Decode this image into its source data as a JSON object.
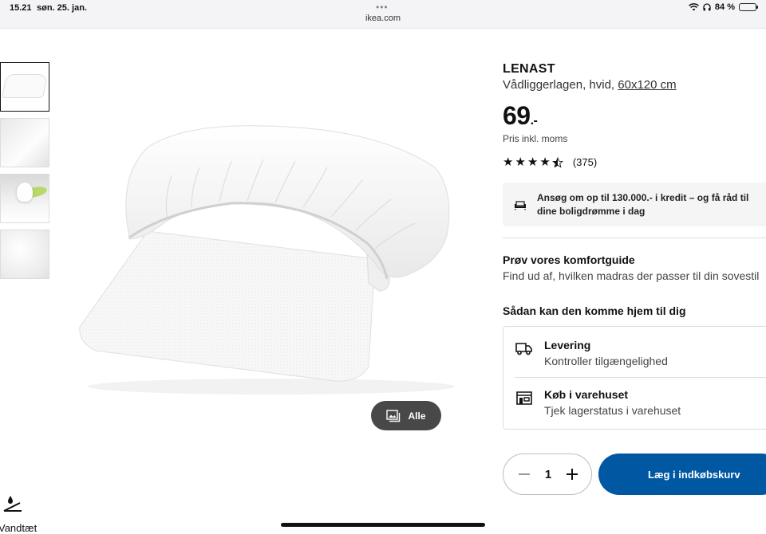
{
  "status_bar": {
    "time": "15.21",
    "date": "søn. 25. jan.",
    "url": "ikea.com",
    "battery": "84 %"
  },
  "gallery": {
    "thumbnails": [
      "thumbnail-1",
      "thumbnail-2",
      "thumbnail-3",
      "thumbnail-4"
    ],
    "all_button_label": "Alle"
  },
  "feature": {
    "label": "Vandtæt"
  },
  "product": {
    "name": "LENAST",
    "description": "Vådliggerlagen, hvid,",
    "size": "60x120 cm",
    "price": "69",
    "price_suffix": ".-",
    "price_note": "Pris inkl. moms",
    "rating": 4.5,
    "review_count": "(375)"
  },
  "credit_banner": {
    "text_line1": "Ansøg om op til 130.000.- i kredit – og få råd til",
    "text_line2": "dine boligdrømme i dag"
  },
  "comfort": {
    "title": "Prøv vores komfortguide",
    "text": "Find ud af, hvilken madras der passer til din sovestil"
  },
  "delivery": {
    "title": "Sådan kan den komme hjem til dig",
    "options": [
      {
        "title": "Levering",
        "subtitle": "Kontroller tilgængelighed",
        "icon": "truck-icon"
      },
      {
        "title": "Køb i varehuset",
        "subtitle": "Tjek lagerstatus i varehuset",
        "icon": "store-icon"
      }
    ]
  },
  "cart": {
    "quantity": "1",
    "add_label": "Læg i indkøbskurv"
  },
  "colors": {
    "primary_blue": "#0058a3",
    "dark_button": "#484848"
  }
}
